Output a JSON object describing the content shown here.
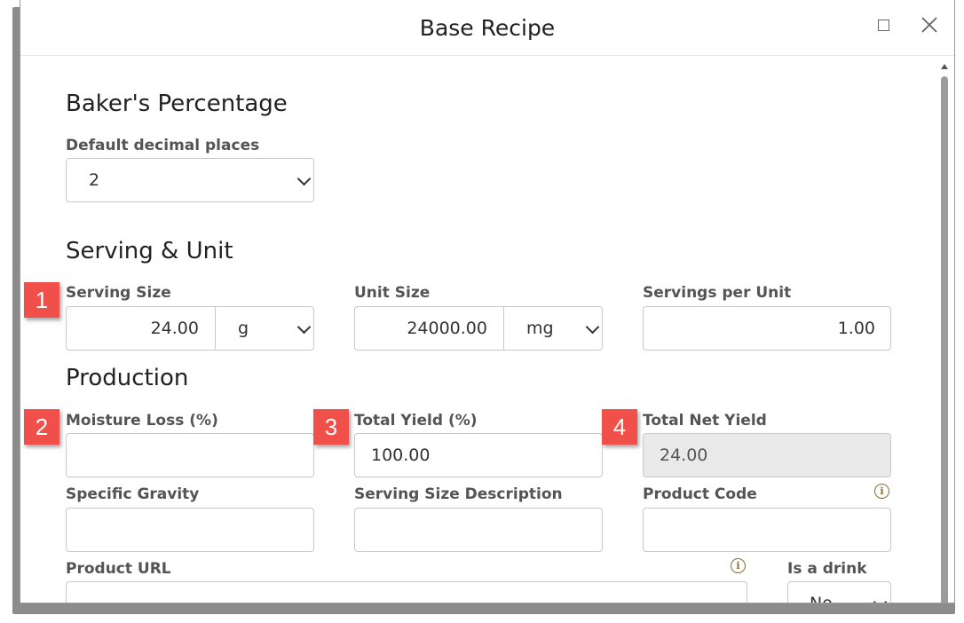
{
  "dialog": {
    "title": "Base Recipe"
  },
  "sections": {
    "bakers_percentage": "Baker's Percentage",
    "serving_unit": "Serving & Unit",
    "production": "Production"
  },
  "bakers": {
    "decimal_label": "Default decimal places",
    "decimal_value": "2"
  },
  "serving": {
    "serving_size_label": "Serving Size",
    "serving_size_value": "24.00",
    "serving_size_unit": "g",
    "unit_size_label": "Unit Size",
    "unit_size_value": "24000.00",
    "unit_size_unit": "mg",
    "servings_per_unit_label": "Servings per Unit",
    "servings_per_unit_value": "1.00"
  },
  "production": {
    "moisture_loss_label": "Moisture Loss (%)",
    "moisture_loss_value": "",
    "total_yield_label": "Total Yield (%)",
    "total_yield_value": "100.00",
    "total_net_yield_label": "Total Net Yield",
    "total_net_yield_value": "24.00",
    "specific_gravity_label": "Specific Gravity",
    "serving_desc_label": "Serving Size Description",
    "product_code_label": "Product Code",
    "product_url_label": "Product URL",
    "is_drink_label": "Is a drink",
    "is_drink_value": "No"
  },
  "badges": [
    "1",
    "2",
    "3",
    "4"
  ],
  "colors": {
    "badge": "#f1504a",
    "info_icon": "#8a6d1f",
    "disabled_field": "#e9e9e9"
  },
  "icons": [
    "maximize-icon",
    "close-icon",
    "chevron-down-icon",
    "info-icon"
  ]
}
